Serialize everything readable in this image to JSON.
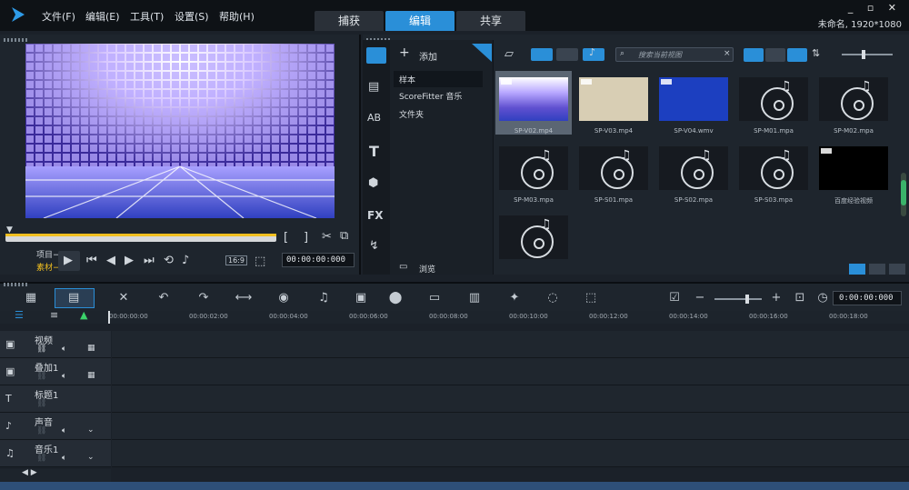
{
  "menu": {
    "file": "文件(F)",
    "edit": "编辑(E)",
    "tools": "工具(T)",
    "settings": "设置(S)",
    "help": "帮助(H)"
  },
  "tabs": {
    "capture": "捕获",
    "edit": "编辑",
    "share": "共享"
  },
  "project": {
    "name": "未命名, 1920*1080"
  },
  "preview": {
    "project_label": "项目−",
    "clip_label": "素材−",
    "aspect": "16:9",
    "timecode": "00:00:00:000",
    "bracket_in": "[",
    "bracket_out": "]"
  },
  "library": {
    "add_label": "添加",
    "tree": [
      "样本",
      "ScoreFitter 音乐",
      "文件夹"
    ],
    "browse": "浏览",
    "search_placeholder": "搜索当前视图",
    "items": [
      {
        "name": "SP-V02.mp4",
        "kind": "video",
        "color": "#4a3fb0"
      },
      {
        "name": "SP-V03.mp4",
        "kind": "video",
        "color": "#d8ceb4"
      },
      {
        "name": "SP-V04.wmv",
        "kind": "video",
        "color": "#1c3fc0"
      },
      {
        "name": "SP-M01.mpa",
        "kind": "audio"
      },
      {
        "name": "SP-M02.mpa",
        "kind": "audio"
      },
      {
        "name": "SP-M03.mpa",
        "kind": "audio"
      },
      {
        "name": "SP-S01.mpa",
        "kind": "audio"
      },
      {
        "name": "SP-S02.mpa",
        "kind": "audio"
      },
      {
        "name": "SP-S03.mpa",
        "kind": "audio"
      },
      {
        "name": "百度经验视频",
        "kind": "video",
        "color": "#000000"
      },
      {
        "name": "",
        "kind": "audio"
      }
    ]
  },
  "timeline": {
    "timecode": "0:00:00:000",
    "ruler": [
      "00:00:00:00",
      "00:00:02:00",
      "00:00:04:00",
      "00:00:06:00",
      "00:00:08:00",
      "00:00:10:00",
      "00:00:12:00",
      "00:00:14:00",
      "00:00:16:00",
      "00:00:18:00"
    ],
    "tracks": [
      "视频",
      "叠加1",
      "标题1",
      "声音",
      "音乐1"
    ]
  }
}
